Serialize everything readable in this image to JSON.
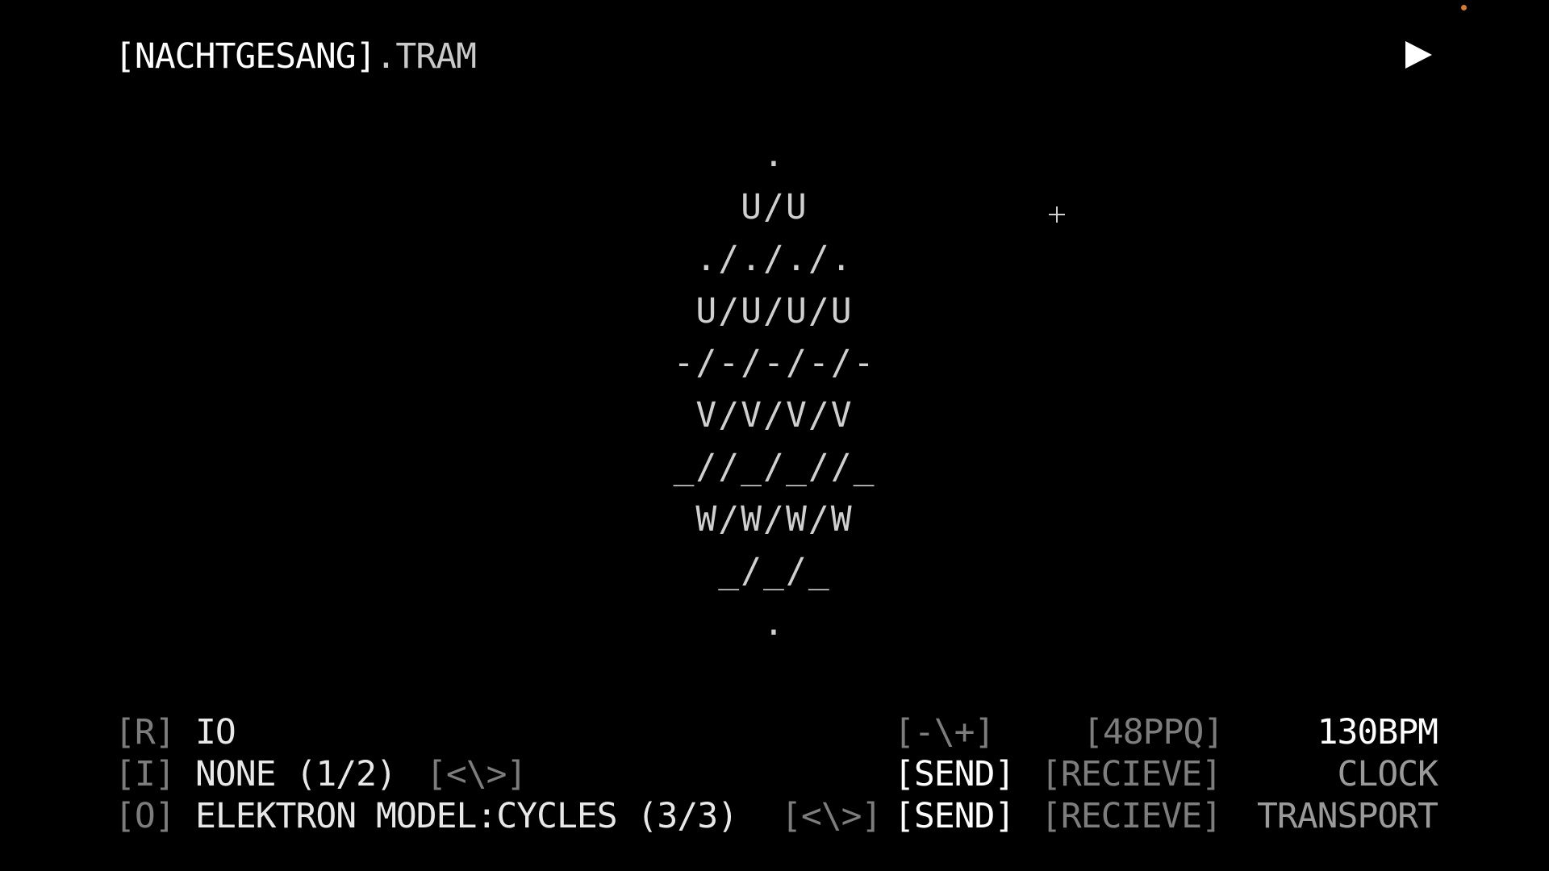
{
  "header": {
    "title_bracket": "[NACHTGESANG]",
    "title_ext": ".TRAM",
    "play_icon": "play-icon"
  },
  "colors": {
    "background": "#000000",
    "text_bright": "#ffffff",
    "text_normal": "#cfcfcf",
    "text_dim": "#7d7d7d",
    "status_dot": "#d97a2a"
  },
  "art": {
    "lines": [
      ".",
      "U/U",
      "./././.",
      "U/U/U/U",
      "-/-/-/-/-",
      "V/V/V/V",
      "_//_/_//_",
      "W/W/W/W",
      "_/_/_",
      "."
    ]
  },
  "panel": {
    "row_r": {
      "key": "[R]",
      "value": "IO",
      "adjust": "[-\\+]",
      "ppq": "[48PPQ]",
      "bpm": "130BPM"
    },
    "row_i": {
      "key": "[I]",
      "value": "NONE (1/2)",
      "nav": "[<\\>]",
      "send": "[SEND]",
      "receive": "[RECIEVE]",
      "mode": "CLOCK"
    },
    "row_o": {
      "key": "[O]",
      "value": "ELEKTRON MODEL:CYCLES (3/3)",
      "nav": "[<\\>]",
      "send": "[SEND]",
      "receive": "[RECIEVE]",
      "mode": "TRANSPORT"
    }
  }
}
